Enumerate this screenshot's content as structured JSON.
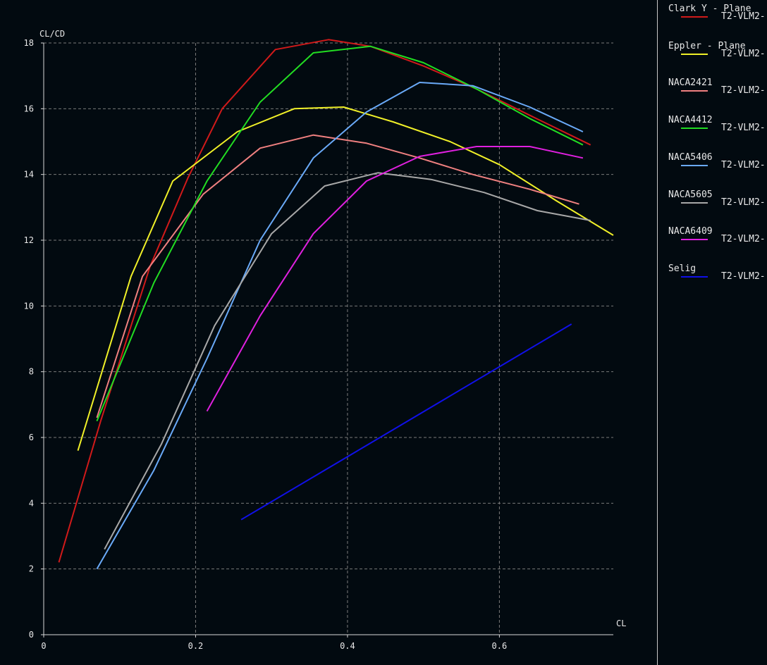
{
  "chart_data": {
    "type": "line",
    "ylabel": "CL/CD",
    "xlabel": "CL",
    "xlim": [
      0,
      0.75
    ],
    "ylim": [
      0,
      18
    ],
    "xticks": [
      0,
      0.2,
      0.4,
      0.6
    ],
    "xtick_labels": [
      "0",
      "0.2",
      "0.4",
      "0.6"
    ],
    "yticks": [
      0,
      2,
      4,
      6,
      8,
      10,
      12,
      14,
      16,
      18
    ],
    "ytick_labels": [
      "0",
      "2",
      "4",
      "6",
      "8",
      "10",
      "12",
      "14",
      "16",
      "18"
    ],
    "grid": true,
    "legend_position": "right",
    "series": [
      {
        "group": "Clark Y - Plane",
        "name": "T2-VLM2-",
        "color": "#d11a1a",
        "x": [
          0.02,
          0.075,
          0.14,
          0.19,
          0.235,
          0.305,
          0.375,
          0.43,
          0.5,
          0.57,
          0.64,
          0.72
        ],
        "y": [
          2.2,
          6.5,
          11.2,
          13.9,
          16.0,
          17.8,
          18.1,
          17.9,
          17.3,
          16.6,
          15.8,
          14.9
        ]
      },
      {
        "group": "Eppler - Plane",
        "name": "T2-VLM2-",
        "color": "#f0f028",
        "x": [
          0.045,
          0.115,
          0.17,
          0.255,
          0.33,
          0.395,
          0.46,
          0.535,
          0.6,
          0.675,
          0.75
        ],
        "y": [
          5.6,
          10.9,
          13.8,
          15.3,
          16.0,
          16.05,
          15.6,
          15.0,
          14.3,
          13.2,
          12.15
        ]
      },
      {
        "group": "NACA2421",
        "name": "T2-VLM2-",
        "color": "#f08080",
        "x": [
          0.07,
          0.13,
          0.21,
          0.285,
          0.355,
          0.425,
          0.495,
          0.565,
          0.64,
          0.705
        ],
        "y": [
          6.6,
          10.9,
          13.4,
          14.8,
          15.2,
          14.95,
          14.5,
          14.0,
          13.55,
          13.1
        ]
      },
      {
        "group": "NACA4412",
        "name": "T2-VLM2-",
        "color": "#22dd22",
        "x": [
          0.07,
          0.145,
          0.215,
          0.285,
          0.355,
          0.43,
          0.5,
          0.57,
          0.64,
          0.71
        ],
        "y": [
          6.5,
          10.7,
          13.8,
          16.2,
          17.7,
          17.9,
          17.4,
          16.6,
          15.7,
          14.9
        ]
      },
      {
        "group": "NACA5406",
        "name": "T2-VLM2-",
        "color": "#6aaaf8",
        "x": [
          0.07,
          0.145,
          0.215,
          0.285,
          0.355,
          0.425,
          0.495,
          0.565,
          0.64,
          0.71
        ],
        "y": [
          2.0,
          5.0,
          8.4,
          12.0,
          14.5,
          15.9,
          16.8,
          16.7,
          16.05,
          15.3
        ]
      },
      {
        "group": "NACA5605",
        "name": "T2-VLM2-",
        "color": "#a8a8a8",
        "x": [
          0.08,
          0.155,
          0.225,
          0.3,
          0.37,
          0.44,
          0.51,
          0.58,
          0.65,
          0.72
        ],
        "y": [
          2.6,
          5.8,
          9.4,
          12.2,
          13.65,
          14.05,
          13.85,
          13.45,
          12.9,
          12.6
        ]
      },
      {
        "group": "NACA6409",
        "name": "T2-VLM2-",
        "color": "#e020e0",
        "x": [
          0.215,
          0.285,
          0.355,
          0.425,
          0.495,
          0.57,
          0.64,
          0.71
        ],
        "y": [
          6.8,
          9.7,
          12.2,
          13.8,
          14.55,
          14.85,
          14.85,
          14.5
        ]
      },
      {
        "group": "Selig",
        "name": "T2-VLM2-",
        "color": "#1010e8",
        "x": [
          0.26,
          0.695
        ],
        "y": [
          3.5,
          9.45
        ]
      }
    ]
  }
}
